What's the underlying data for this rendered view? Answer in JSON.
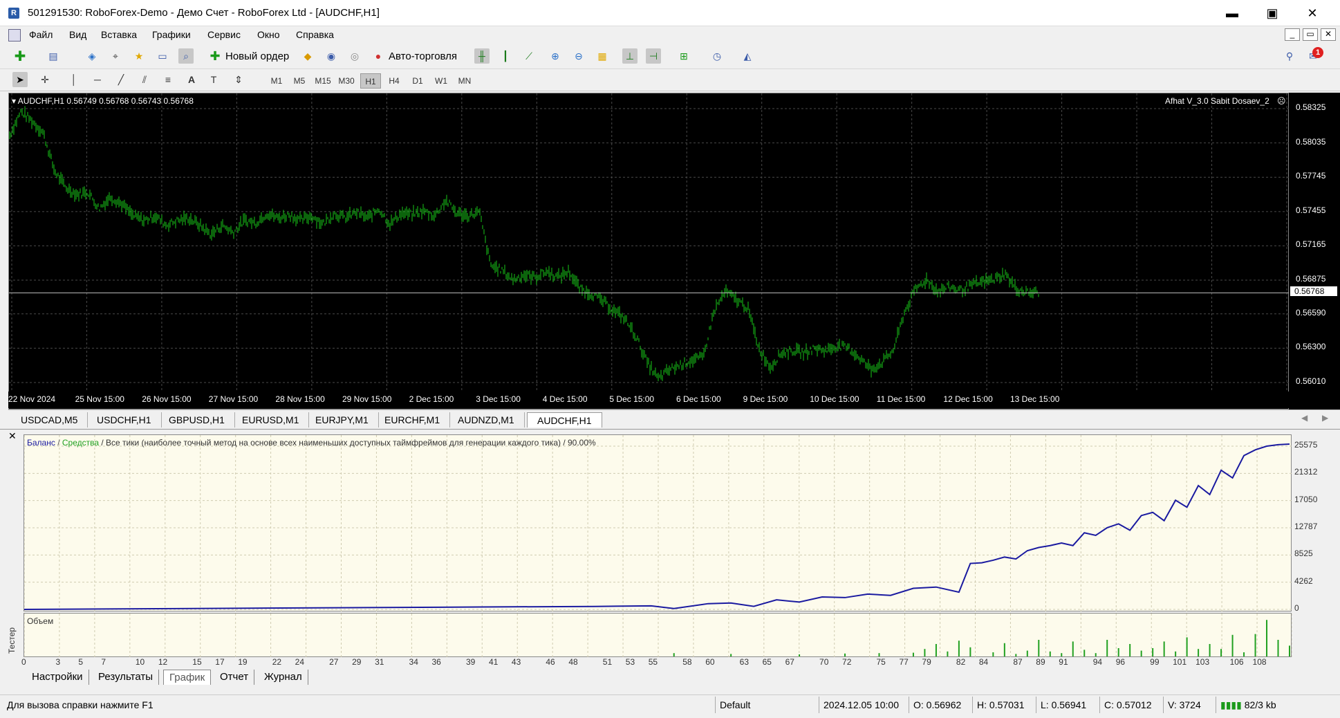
{
  "window": {
    "title": "501291530: RoboForex-Demo - Демо Счет - RoboForex Ltd - [AUDCHF,H1]",
    "minimize": "▬",
    "maximize": "▣",
    "close": "✕",
    "sub_min": "_",
    "sub_restore": "▭",
    "sub_close": "✕"
  },
  "menu": [
    "Файл",
    "Вид",
    "Вставка",
    "Графики",
    "Сервис",
    "Окно",
    "Справка"
  ],
  "toolbar": {
    "new_order": "Новый ордер",
    "autotrading": "Авто-торговля",
    "notification_count": "1"
  },
  "timeframes": [
    "M1",
    "M5",
    "M15",
    "M30",
    "H1",
    "H4",
    "D1",
    "W1",
    "MN"
  ],
  "active_timeframe": "H1",
  "chart": {
    "header": "AUDCHF,H1  0.56749 0.56768 0.56743 0.56768",
    "expert": "Afhat V_3.0 Sabit Dosaev_2",
    "current_price": "0.56768",
    "bar_color": "#18c818",
    "price_labels": [
      "0.58325",
      "0.58035",
      "0.57745",
      "0.57455",
      "0.57165",
      "0.56875",
      "0.56590",
      "0.56300",
      "0.56010"
    ],
    "time_labels": [
      "22 Nov 2024",
      "25 Nov 15:00",
      "26 Nov 15:00",
      "27 Nov 15:00",
      "28 Nov 15:00",
      "29 Nov 15:00",
      "2 Dec 15:00",
      "3 Dec 15:00",
      "4 Dec 15:00",
      "5 Dec 15:00",
      "6 Dec 15:00",
      "9 Dec 15:00",
      "10 Dec 15:00",
      "11 Dec 15:00",
      "12 Dec 15:00",
      "13 Dec 15:00"
    ],
    "price_series": [
      0.581,
      0.583,
      0.5822,
      0.5812,
      0.578,
      0.5766,
      0.576,
      0.5762,
      0.5748,
      0.5758,
      0.5752,
      0.5742,
      0.5738,
      0.5742,
      0.5734,
      0.5738,
      0.574,
      0.5734,
      0.5726,
      0.5734,
      0.5728,
      0.5738,
      0.5736,
      0.5744,
      0.574,
      0.5743,
      0.5738,
      0.5742,
      0.5735,
      0.5744,
      0.574,
      0.5745,
      0.574,
      0.5748,
      0.5735,
      0.5744,
      0.5743,
      0.5746,
      0.5742,
      0.5755,
      0.5744,
      0.5742,
      0.5745,
      0.57,
      0.5696,
      0.5688,
      0.5692,
      0.569,
      0.5695,
      0.569,
      0.5695,
      0.568,
      0.5676,
      0.567,
      0.5662,
      0.5655,
      0.564,
      0.5618,
      0.5604,
      0.5612,
      0.5616,
      0.562,
      0.5622,
      0.5662,
      0.5678,
      0.5671,
      0.5664,
      0.563,
      0.5614,
      0.5626,
      0.5628,
      0.5626,
      0.563,
      0.5628,
      0.5632,
      0.563,
      0.5622,
      0.5612,
      0.5618,
      0.5628,
      0.566,
      0.568,
      0.5688,
      0.5678,
      0.5682,
      0.5679,
      0.5683,
      0.5686,
      0.5688,
      0.5693,
      0.568,
      0.5677,
      0.5677
    ]
  },
  "chart_tabs": [
    "USDCAD,M5",
    "USDCHF,H1",
    "GBPUSD,H1",
    "EURUSD,M1",
    "EURJPY,M1",
    "EURCHF,M1",
    "AUDNZD,M1",
    "AUDCHF,H1"
  ],
  "active_chart_tab": "AUDCHF,H1",
  "tester": {
    "side_label": "Тестер",
    "header_balance": "Баланс",
    "header_sep": " / ",
    "header_equity": "Средства",
    "header_desc": " / Все тики (наиболее точный метод на основе всех наименьших доступных таймфреймов для генерации каждого тика) / 90.00%",
    "balance_color": "#1a1aa0",
    "equity_color": "#20a020",
    "volume_label": "Объем",
    "y_labels": [
      "25575",
      "21312",
      "17050",
      "12787",
      "8525",
      "4262",
      "0"
    ],
    "x_labels": [
      "0",
      "3",
      "5",
      "7",
      "10",
      "12",
      "15",
      "17",
      "19",
      "22",
      "24",
      "27",
      "29",
      "31",
      "34",
      "36",
      "39",
      "41",
      "43",
      "46",
      "48",
      "51",
      "53",
      "55",
      "58",
      "60",
      "63",
      "65",
      "67",
      "70",
      "72",
      "75",
      "77",
      "79",
      "82",
      "84",
      "87",
      "89",
      "91",
      "94",
      "96",
      "99",
      "101",
      "103",
      "106",
      "108"
    ],
    "tabs": [
      "Настройки",
      "Результаты",
      "График",
      "Отчет",
      "Журнал"
    ],
    "active_tab": "График",
    "close": "✕"
  },
  "chart_data": {
    "type": "line",
    "title": "",
    "series": [
      {
        "name": "Баланс",
        "x": [
          0,
          10,
          20,
          30,
          40,
          50,
          55,
          57,
          60,
          62,
          64,
          66,
          68,
          70,
          72,
          74,
          76,
          78,
          80,
          82,
          83,
          84,
          85,
          86,
          87,
          88,
          89,
          90,
          91,
          92,
          93,
          94,
          95,
          96,
          97,
          98,
          99,
          100,
          101,
          102,
          103,
          104,
          105,
          106,
          107,
          108,
          109,
          110,
          111
        ],
        "values": [
          0,
          90,
          190,
          280,
          380,
          460,
          560,
          140,
          900,
          1000,
          480,
          1500,
          1150,
          1950,
          1850,
          2400,
          2200,
          3300,
          3500,
          2700,
          7200,
          7300,
          7700,
          8200,
          7900,
          9200,
          9700,
          10000,
          10400,
          10000,
          12000,
          11600,
          12800,
          13400,
          12400,
          14700,
          15200,
          13900,
          17100,
          16000,
          19400,
          18000,
          21800,
          20600,
          24100,
          25000,
          25575,
          25800,
          25900
        ]
      }
    ],
    "ylim": [
      0,
      25575
    ],
    "xlim": [
      0,
      111
    ],
    "volume": {
      "label": "Объем",
      "x": [
        57,
        62,
        68,
        72,
        75,
        78,
        79,
        80,
        81,
        82,
        83,
        85,
        86,
        87,
        88,
        89,
        90,
        91,
        92,
        93,
        94,
        95,
        96,
        97,
        98,
        99,
        100,
        101,
        102,
        103,
        104,
        105,
        106,
        107,
        108,
        109,
        110,
        111
      ],
      "values": [
        8,
        6,
        5,
        7,
        8,
        9,
        18,
        30,
        12,
        38,
        22,
        10,
        32,
        6,
        14,
        40,
        12,
        8,
        36,
        16,
        8,
        40,
        20,
        30,
        14,
        20,
        36,
        12,
        46,
        18,
        30,
        18,
        52,
        10,
        54,
        88,
        40,
        26
      ]
    }
  },
  "status": {
    "help": "Для вызова справки нажмите F1",
    "profile": "Default",
    "datetime": "2024.12.05 10:00",
    "open": "O: 0.56962",
    "high": "H: 0.57031",
    "low": "L: 0.56941",
    "close": "C: 0.57012",
    "volume": "V: 3724",
    "traffic": "82/3 kb"
  }
}
